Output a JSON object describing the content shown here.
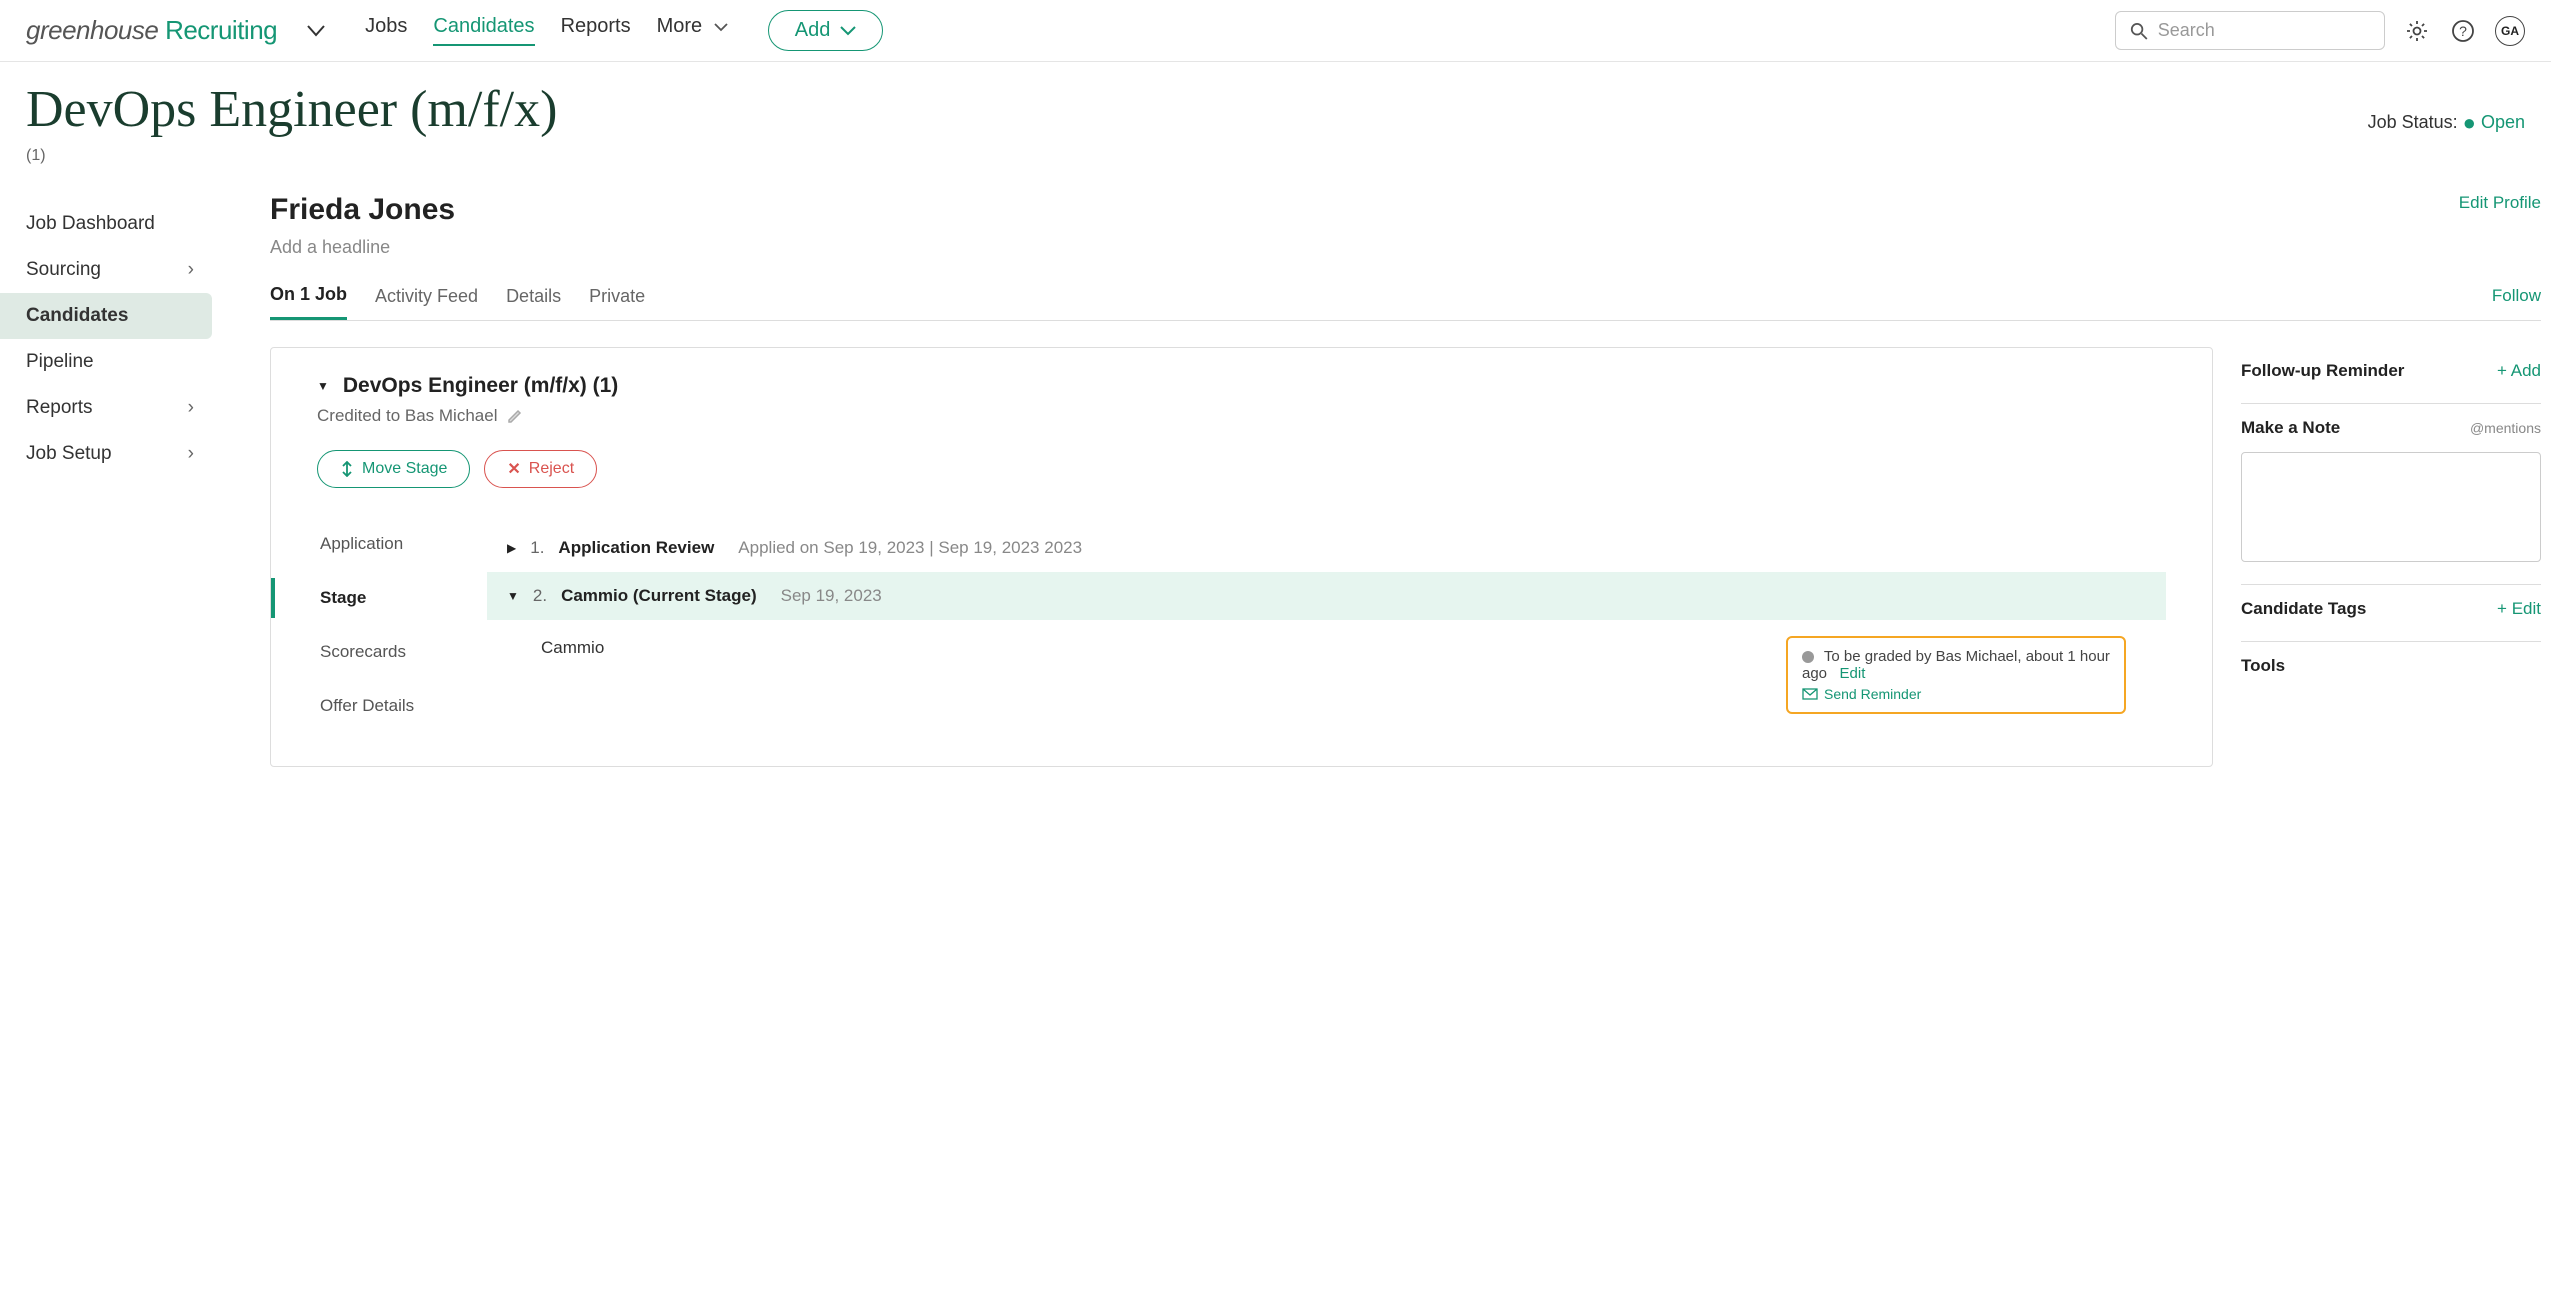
{
  "brand": {
    "part1": "greenhouse",
    "part2": " Recruiting"
  },
  "nav": {
    "jobs": "Jobs",
    "candidates": "Candidates",
    "reports": "Reports",
    "more": "More"
  },
  "add_label": "Add",
  "search": {
    "placeholder": "Search"
  },
  "avatar_initials": "GA",
  "page_title": "DevOps Engineer (m/f/x)",
  "sub_count": "(1)",
  "job_status_label": "Job Status: ",
  "job_status_value": "Open",
  "sidebar": {
    "dashboard": "Job Dashboard",
    "sourcing": "Sourcing",
    "candidates": "Candidates",
    "pipeline": "Pipeline",
    "reports": "Reports",
    "setup": "Job Setup"
  },
  "candidate": {
    "name": "Frieda Jones",
    "edit_profile": "Edit Profile",
    "headline_placeholder": "Add a headline"
  },
  "tabs": {
    "onjob": "On 1 Job",
    "activity": "Activity Feed",
    "details": "Details",
    "private": "Private",
    "follow": "Follow"
  },
  "job_card": {
    "title": "DevOps Engineer (m/f/x) (1)",
    "credited": "Credited to Bas Michael",
    "move_stage": "Move Stage",
    "reject": "Reject"
  },
  "stage_nav": {
    "application": "Application",
    "stage": "Stage",
    "scorecards": "Scorecards",
    "offer": "Offer Details"
  },
  "stages": {
    "s1_num": "1.",
    "s1_label": "Application Review",
    "s1_meta": "Applied on Sep 19, 2023 | Sep 19, 2023 2023",
    "s2_num": "2.",
    "s2_label": "Cammio (Current Stage)",
    "s2_meta": "Sep 19, 2023",
    "sub_label": "Cammio"
  },
  "highlight": {
    "text": "To be graded by Bas Michael, about 1 hour ago",
    "edit": "Edit",
    "send": "Send Reminder"
  },
  "right": {
    "followup": "Follow-up Reminder",
    "add": "+ Add",
    "note": "Make a Note",
    "mentions": "@mentions",
    "tags": "Candidate Tags",
    "edit": "+ Edit",
    "tools": "Tools"
  }
}
